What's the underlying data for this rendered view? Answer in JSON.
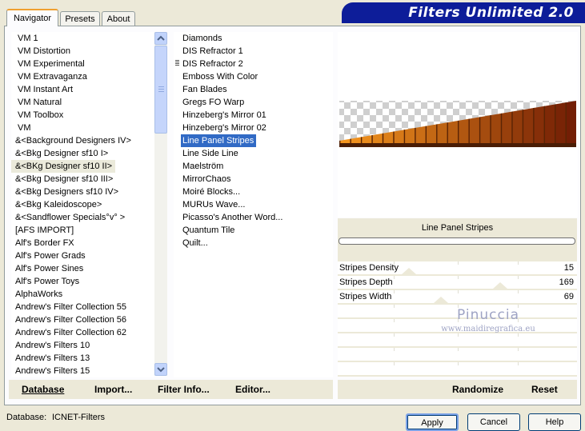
{
  "banner": {
    "title": "Filters Unlimited 2.0"
  },
  "tabs": [
    {
      "label": "Navigator",
      "active": true
    },
    {
      "label": "Presets",
      "active": false
    },
    {
      "label": "About",
      "active": false
    }
  ],
  "categories": {
    "items": [
      "VM 1",
      "VM Distortion",
      "VM Experimental",
      "VM Extravaganza",
      "VM Instant Art",
      "VM Natural",
      "VM Toolbox",
      "VM",
      "&<Background Designers IV>",
      "&<Bkg Designer sf10 I>",
      "&<BKg Designer sf10 II>",
      "&<Bkg Designer sf10 III>",
      "&<Bkg Designers sf10 IV>",
      "&<Bkg Kaleidoscope>",
      "&<Sandflower Specials°v° >",
      "[AFS IMPORT]",
      "Alf's Border FX",
      "Alf's Power Grads",
      "Alf's Power Sines",
      "Alf's Power Toys",
      "AlphaWorks",
      "Andrew's Filter Collection 55",
      "Andrew's Filter Collection 56",
      "Andrew's Filter Collection 62",
      "Andrew's Filters 10",
      "Andrew's Filters 13",
      "Andrew's Filters 15"
    ],
    "highlighted_index": 10
  },
  "filters": {
    "items": [
      "Diamonds",
      "DIS Refractor 1",
      "DIS Refractor 2",
      "Emboss With Color",
      "Fan Blades",
      "Gregs FO Warp",
      "Hinzeberg's Mirror 01",
      "Hinzeberg's Mirror 02",
      "Line Panel Stripes",
      "Line Side Line",
      "Maelström",
      "MirrorChaos",
      "Moiré Blocks...",
      "MURUs Wave...",
      "Picasso's Another Word...",
      "Quantum Tile",
      "Quilt..."
    ],
    "selected_index": 8
  },
  "preview": {
    "filter_name": "Line Panel Stripes",
    "progress": 0
  },
  "parameters": [
    {
      "label": "Stripes Density",
      "value": "15",
      "fraction": 0.06
    },
    {
      "label": "Stripes Depth",
      "value": "169",
      "fraction": 0.66
    },
    {
      "label": "Stripes Width",
      "value": "69",
      "fraction": 0.27
    }
  ],
  "watermark": {
    "name": "Pinuccia",
    "url": "www.maidiregrafica.eu"
  },
  "bottom_left": {
    "database": "Database",
    "import": "Import...",
    "filter_info": "Filter Info...",
    "editor": "Editor..."
  },
  "bottom_right": {
    "randomize": "Randomize",
    "reset": "Reset"
  },
  "status": {
    "database_label": "Database:",
    "database_value": "ICNET-Filters"
  },
  "buttons": {
    "apply": "Apply",
    "cancel": "Cancel",
    "help": "Help"
  },
  "colors": {
    "selection": "#316ac5",
    "banner": "#0d1d99",
    "accent_tab": "#f0a030",
    "stripe_orange": "#f08010"
  }
}
